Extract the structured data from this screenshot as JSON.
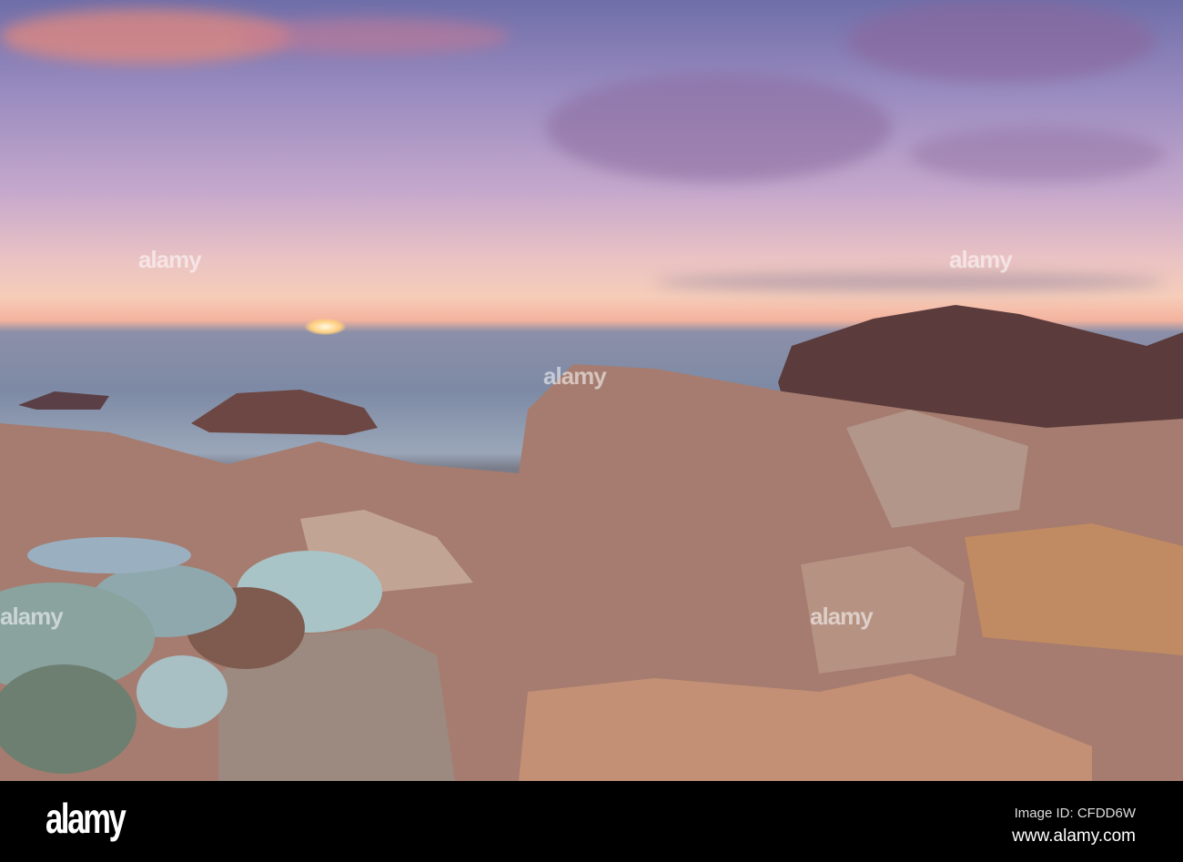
{
  "watermark": {
    "brand": "alamy",
    "image_id_label": "Image ID: CFDD6W",
    "url": "www.alamy.com"
  },
  "scene": {
    "sky_colors": [
      "#6f6ea8",
      "#e9c2c4",
      "#f4b39e"
    ],
    "sea_color": "#7d8aa5",
    "rock_color": "#b48a78",
    "plant_color": "#9fb8bf"
  }
}
